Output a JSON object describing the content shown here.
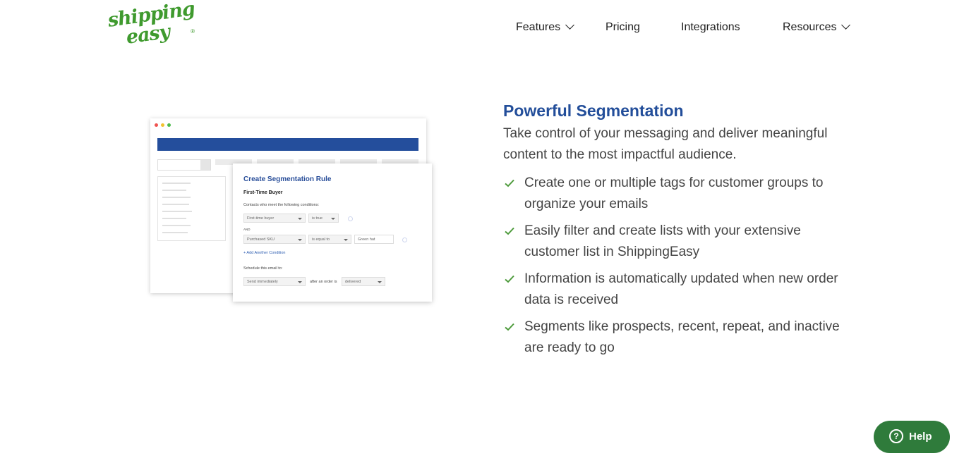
{
  "header": {
    "logo_line1": "shipping",
    "logo_line2": "easy",
    "logo_reg": "®",
    "nav": [
      {
        "label": "Features",
        "dropdown": true
      },
      {
        "label": "Pricing",
        "dropdown": false
      },
      {
        "label": "Integrations",
        "dropdown": false
      },
      {
        "label": "Resources",
        "dropdown": true
      }
    ]
  },
  "mockup": {
    "window_dots": [
      "#ef5350",
      "#f2c230",
      "#4cbb4c"
    ],
    "rule_title": "Create Segmentation Rule",
    "rule_name": "First-Time Buyer",
    "conditions_label": "Contacts who meet the following conditions:",
    "cond1_field": "First-time buyer",
    "cond1_op": "is true",
    "and_label": "AND",
    "cond2_field": "Purchased SKU",
    "cond2_op": "is equal to",
    "cond2_value": "Green hat",
    "add_condition": "+ Add Another Condition",
    "schedule_label": "Schedule this email to:",
    "schedule_value": "Send immediately",
    "after_label": "after an order is",
    "after_value": "delivered"
  },
  "content": {
    "heading": "Powerful Segmentation",
    "intro": "Take control of your messaging and deliver meaningful content to the most impactful audience.",
    "features": [
      "Create one or multiple tags for customer groups to organize your emails",
      "Easily filter and create lists with your extensive customer list in ShippingEasy",
      "Information is automatically updated when new order data is received",
      "Segments like prospects, recent, repeat, and inactive are ready to go"
    ]
  },
  "help": {
    "label": "Help",
    "icon": "question-circle-icon"
  },
  "colors": {
    "brand_green": "#3f9a2e",
    "heading_blue": "#234e9a",
    "help_green": "#2f7b3b",
    "check_green": "#4c9a3a"
  }
}
